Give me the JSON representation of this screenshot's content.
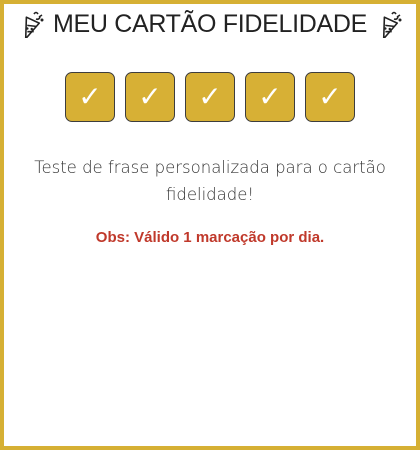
{
  "header": {
    "title": "MEU CARTÃO FIDELIDADE",
    "left_icon": "party-popper-icon",
    "right_icon": "party-popper-icon"
  },
  "stamps": {
    "total": 5,
    "checked": 5,
    "items": [
      {
        "symbol": "✓",
        "checked": true
      },
      {
        "symbol": "✓",
        "checked": true
      },
      {
        "symbol": "✓",
        "checked": true
      },
      {
        "symbol": "✓",
        "checked": true
      },
      {
        "symbol": "✓",
        "checked": true
      }
    ]
  },
  "message": "Teste de frase personalizada para o cartão fidelidade!",
  "obs": "Obs: Válido 1 marcação por dia.",
  "colors": {
    "border": "#d6b034",
    "stamp_fill": "#d7b035",
    "stamp_outline": "#3d3d3d",
    "check": "#ffffff",
    "obs_text": "#c0392b",
    "title_text": "#222222"
  }
}
